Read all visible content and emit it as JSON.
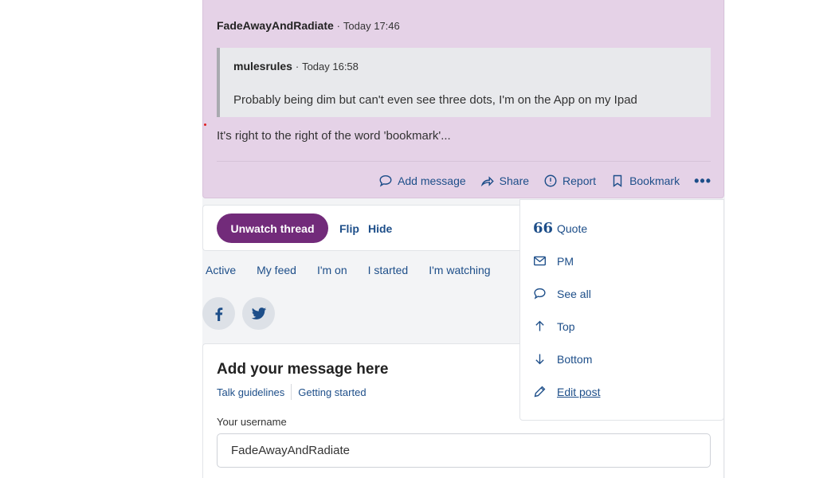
{
  "post": {
    "author": "FadeAwayAndRadiate",
    "separator": "·",
    "time": "Today 17:46",
    "quote": {
      "author": "mulesrules",
      "time": "Today 16:58",
      "text": "Probably being dim but can't even see three dots, I'm on the App on my Ipad"
    },
    "body": "It's right to the right of the word 'bookmark'...",
    "actions": {
      "add_message": "Add message",
      "share": "Share",
      "report": "Report",
      "bookmark": "Bookmark",
      "more": "•••"
    }
  },
  "watch_bar": {
    "unwatch": "Unwatch thread",
    "flip": "Flip",
    "hide": "Hide"
  },
  "feed_nav": [
    "Active",
    "My feed",
    "I'm on",
    "I started",
    "I'm watching"
  ],
  "social": {
    "facebook_icon": "facebook-icon",
    "twitter_icon": "twitter-icon"
  },
  "compose": {
    "title": "Add your message here",
    "talk_guidelines": "Talk guidelines",
    "getting_started": "Getting started",
    "username_label": "Your username",
    "username_value": "FadeAwayAndRadiate"
  },
  "menu": {
    "quote": "Quote",
    "quote_glyph": "66",
    "pm": "PM",
    "see_all": "See all",
    "top": "Top",
    "bottom": "Bottom",
    "edit_post": "Edit post"
  },
  "colors": {
    "post_bg": "#e5d2e7",
    "accent_purple": "#722b7a",
    "link_blue": "#1d4e89"
  }
}
